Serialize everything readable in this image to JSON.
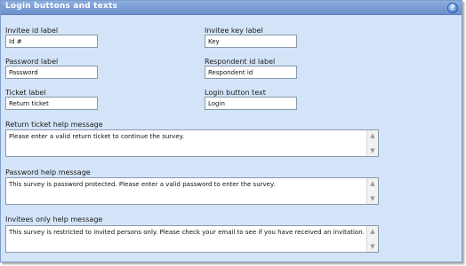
{
  "panel": {
    "title": "Login buttons and texts",
    "help_icon": "?"
  },
  "fields": {
    "invitee_id": {
      "label": "Invitee id label",
      "value": "Id #"
    },
    "invitee_key": {
      "label": "Invitee key label",
      "value": "Key"
    },
    "password": {
      "label": "Password label",
      "value": "Password"
    },
    "respondent_id": {
      "label": "Respondent id label",
      "value": "Respondent id"
    },
    "ticket": {
      "label": "Ticket label",
      "value": "Return ticket"
    },
    "login_button": {
      "label": "Login button text",
      "value": "Login"
    }
  },
  "messages": {
    "return_ticket": {
      "label": "Return ticket help message",
      "value": "Please enter a valid return ticket to continue the survey."
    },
    "password": {
      "label": "Password help message",
      "value": "This survey is password protected. Please enter a valid password to enter the survey."
    },
    "invitees_only": {
      "label": "Invitees only help message",
      "value": "This survey is restricted to invited persons only. Please check your email to see if you have received an invitation."
    }
  },
  "scroll_icons": {
    "up": "up-arrow-icon",
    "down": "down-arrow-icon"
  }
}
